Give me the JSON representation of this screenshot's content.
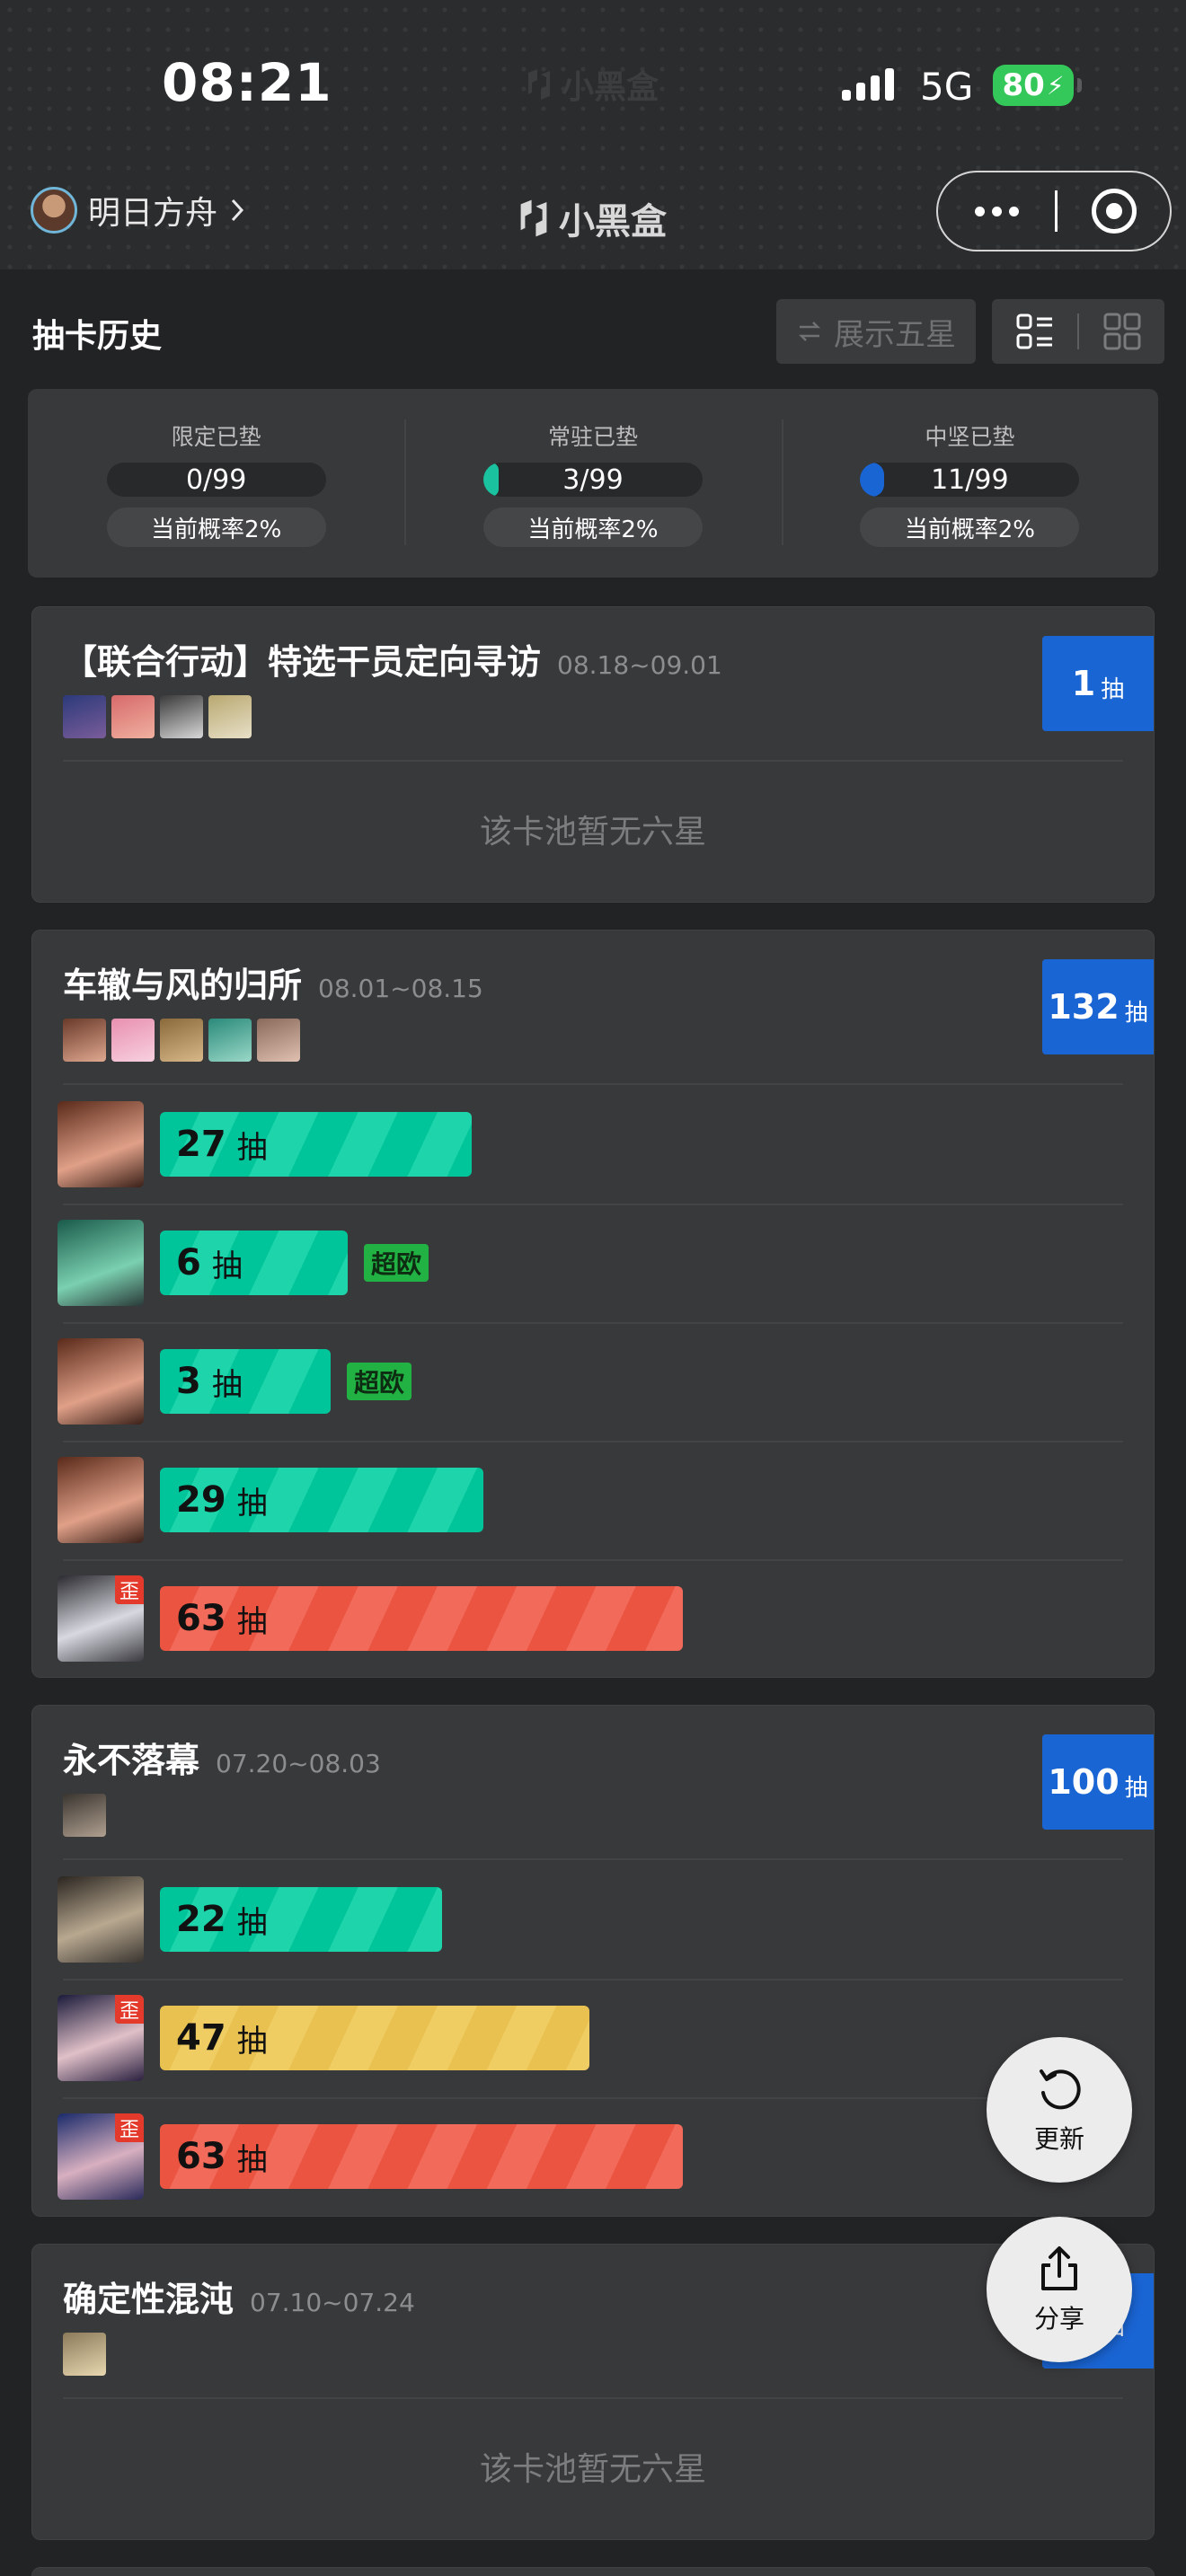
{
  "status_bar": {
    "time": "08:21",
    "app_watermark": "小黑盒",
    "network": "5G",
    "battery": "80"
  },
  "nav": {
    "game_name": "明日方舟",
    "logo_text": "小黑盒",
    "icons": [
      "chevron-right-icon",
      "more-icon",
      "close-target-icon"
    ]
  },
  "toolbar": {
    "title": "抽卡历史",
    "five_star_toggle": "展示五星",
    "icons": [
      "swap-icon",
      "list-view-icon",
      "grid-view-icon"
    ]
  },
  "pity": [
    {
      "label": "限定已垫",
      "value": "0/99",
      "fill_fraction": 0.0,
      "fill_color": "#1bc2a0",
      "rate": "当前概率2%"
    },
    {
      "label": "常驻已垫",
      "value": "3/99",
      "fill_fraction": 0.03,
      "fill_color": "#1bc2a0",
      "rate": "当前概率2%"
    },
    {
      "label": "中坚已垫",
      "value": "11/99",
      "fill_fraction": 0.11,
      "fill_color": "#1a65d4",
      "rate": "当前概率2%"
    }
  ],
  "pools": [
    {
      "title": "【联合行动】特选干员定向寻访",
      "date": "08.18~09.01",
      "count": "1",
      "unit": "抽",
      "operators": 4,
      "empty_text": "该卡池暂无六星",
      "pulls": []
    },
    {
      "title": "车辙与风的归所",
      "date": "08.01~08.15",
      "count": "132",
      "unit": "抽",
      "operators": 5,
      "empty_text": "",
      "pulls": [
        {
          "count": "27",
          "unit": "抽",
          "color": "green",
          "tag": "",
          "skewed": false
        },
        {
          "count": "6",
          "unit": "抽",
          "color": "green",
          "tag": "超欧",
          "skewed": false
        },
        {
          "count": "3",
          "unit": "抽",
          "color": "green",
          "tag": "超欧",
          "skewed": false
        },
        {
          "count": "29",
          "unit": "抽",
          "color": "green",
          "tag": "",
          "skewed": false
        },
        {
          "count": "63",
          "unit": "抽",
          "color": "red",
          "tag": "",
          "skewed": true,
          "skew_label": "歪"
        }
      ]
    },
    {
      "title": "永不落幕",
      "date": "07.20~08.03",
      "count": "100",
      "unit": "抽",
      "operators": 1,
      "empty_text": "",
      "pulls": [
        {
          "count": "22",
          "unit": "抽",
          "color": "green",
          "tag": "",
          "skewed": false
        },
        {
          "count": "47",
          "unit": "抽",
          "color": "yellow",
          "tag": "",
          "skewed": true,
          "skew_label": "歪"
        },
        {
          "count": "63",
          "unit": "抽",
          "color": "red",
          "tag": "",
          "skewed": true,
          "skew_label": "歪"
        }
      ]
    },
    {
      "title": "确定性混沌",
      "date": "07.10~07.24",
      "count": "3",
      "unit": "抽",
      "operators": 1,
      "empty_text": "该卡池暂无六星",
      "pulls": []
    }
  ],
  "fabs": {
    "refresh_label": "更新",
    "share_label": "分享"
  },
  "colors": {
    "accent_blue": "#1a65d4",
    "bar_green": "#00c49a",
    "bar_red": "#ec5442",
    "bar_yellow": "#e9c150",
    "lucky_green": "#21b243"
  }
}
